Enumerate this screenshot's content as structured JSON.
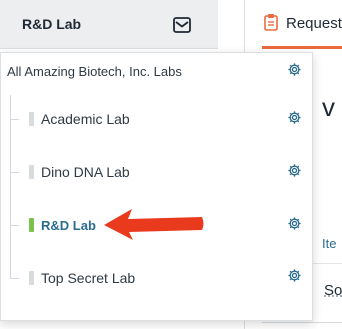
{
  "header": {
    "current_lab": "R&D Lab",
    "inbox_icon": "envelope-icon",
    "requests_tab": {
      "label": "Request",
      "icon": "clipboard-icon"
    }
  },
  "background": {
    "heading_fragment": "v R",
    "column_label_fragment": "Ite",
    "cell_fragment": "So"
  },
  "dropdown": {
    "organization": {
      "label": "All Amazing Biotech, Inc. Labs",
      "settings_icon": "gear-icon"
    },
    "labs": [
      {
        "label": "Academic Lab",
        "active": false,
        "settings_icon": "gear-icon"
      },
      {
        "label": "Dino DNA Lab",
        "active": false,
        "settings_icon": "gear-icon"
      },
      {
        "label": "R&D Lab",
        "active": true,
        "settings_icon": "gear-icon"
      },
      {
        "label": "Top Secret Lab",
        "active": false,
        "settings_icon": "gear-icon"
      }
    ]
  },
  "colors": {
    "accent": "#2b6b90",
    "active_marker": "#7cc24a",
    "tab_underline": "#ea6a3f",
    "annotation_arrow": "#ea3a1e"
  }
}
